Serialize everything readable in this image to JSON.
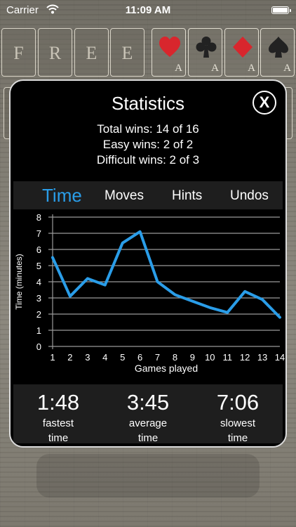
{
  "status_bar": {
    "carrier": "Carrier",
    "time": "11:09 AM"
  },
  "free_cells": [
    "F",
    "R",
    "E",
    "E"
  ],
  "foundations": [
    {
      "suit": "heart-icon",
      "rank": "A",
      "color": "#d8262d"
    },
    {
      "suit": "club-icon",
      "rank": "A",
      "color": "#222222"
    },
    {
      "suit": "diamond-icon",
      "rank": "A",
      "color": "#d8262d"
    },
    {
      "suit": "spade-icon",
      "rank": "A",
      "color": "#222222"
    }
  ],
  "modal": {
    "title": "Statistics",
    "close_label": "X",
    "summary": {
      "total_wins": "Total wins: 14 of 16",
      "easy_wins": "Easy wins: 2 of 2",
      "difficult_wins": "Difficult wins: 2 of 3"
    },
    "tabs": [
      {
        "label": "Time",
        "active": true
      },
      {
        "label": "Moves",
        "active": false
      },
      {
        "label": "Hints",
        "active": false
      },
      {
        "label": "Undos",
        "active": false
      }
    ],
    "stats": [
      {
        "value": "1:48",
        "label_line1": "fastest",
        "label_line2": "time"
      },
      {
        "value": "3:45",
        "label_line1": "average",
        "label_line2": "time"
      },
      {
        "value": "7:06",
        "label_line1": "slowest",
        "label_line2": "time"
      }
    ]
  },
  "colors": {
    "accent": "#2a9de8",
    "modal_bg": "#000000",
    "panel_bg": "#1e1e1e"
  },
  "chart_data": {
    "type": "line",
    "xlabel": "Games played",
    "ylabel": "Time (minutes)",
    "x": [
      1,
      2,
      3,
      4,
      5,
      6,
      7,
      8,
      9,
      10,
      11,
      12,
      13,
      14
    ],
    "series": [
      {
        "values": [
          5.5,
          3.1,
          4.2,
          3.8,
          6.4,
          7.1,
          4.0,
          3.2,
          2.8,
          2.4,
          2.1,
          3.4,
          2.9,
          1.8
        ]
      }
    ],
    "xlim": [
      1,
      14
    ],
    "ylim": [
      0,
      8
    ],
    "yticks": [
      0,
      1,
      2,
      3,
      4,
      5,
      6,
      7,
      8
    ],
    "grid": true,
    "line_color": "#2a9de8"
  }
}
